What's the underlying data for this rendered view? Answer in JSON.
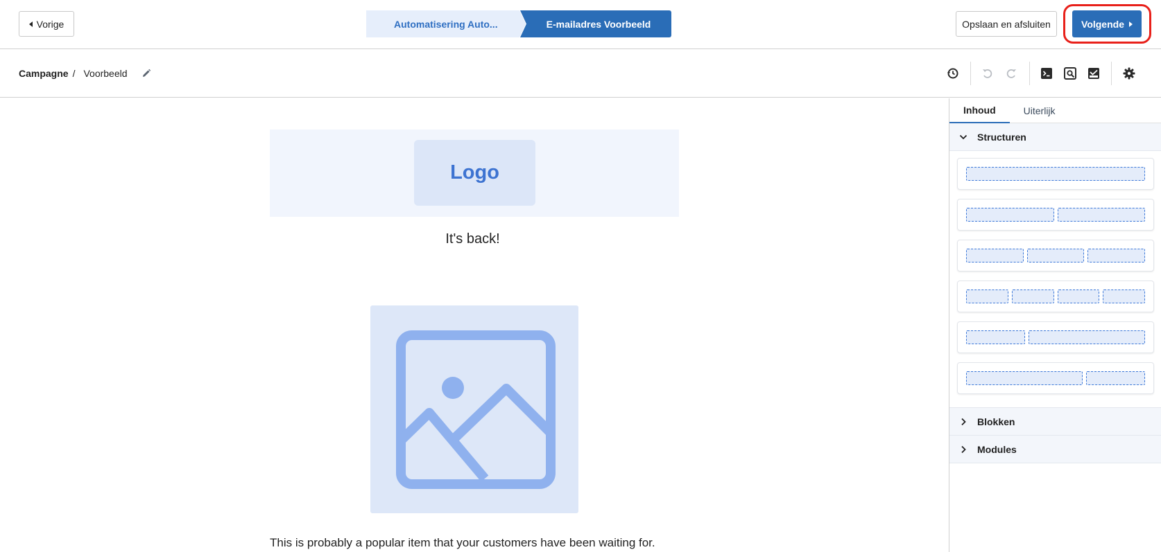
{
  "topbar": {
    "prev_label": "Vorige",
    "steps": [
      "Automatisering Auto...",
      "E-mailadres Voorbeeld"
    ],
    "save_label": "Opslaan en afsluiten",
    "next_label": "Volgende"
  },
  "breadcrumb": {
    "root": "Campagne",
    "separator": "/",
    "current": "Voorbeeld"
  },
  "toolbar_icons": [
    "history-icon",
    "undo-icon",
    "redo-icon",
    "code-icon",
    "preview-icon",
    "inbox-icon",
    "settings-icon"
  ],
  "canvas": {
    "logo_text": "Logo",
    "headline": "It's back!",
    "body_text": "This is probably a popular item that your customers have been waiting for."
  },
  "panel": {
    "tabs": [
      "Inhoud",
      "Uiterlijk"
    ],
    "active_tab": "Inhoud",
    "sections": {
      "structuren": "Structuren",
      "blokken": "Blokken",
      "modules": "Modules"
    }
  },
  "colors": {
    "primary": "#2a6db7",
    "highlight_ring": "#e8201a",
    "logo_text": "#3d73d1",
    "placeholder_bg": "#dde7f8"
  }
}
